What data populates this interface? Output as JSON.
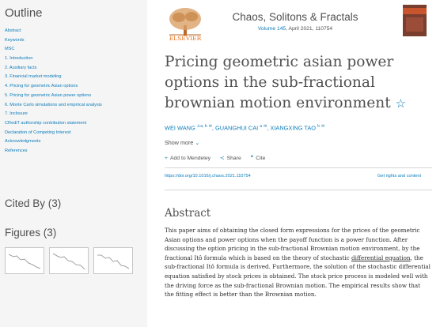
{
  "sidebar": {
    "outline_title": "Outline",
    "items": [
      "Abstract",
      "Keywords",
      "MSC",
      "1. Introduction",
      "2. Auxiliary facts",
      "3. Financial market modeling",
      "4. Pricing for geometric Asian options",
      "5. Pricing for geometric Asian power options",
      "6. Monte Carlo simulations and empirical analysis",
      "7. Inclosure",
      "CRediT authorship contribution statement",
      "Declaration of Competing Interest",
      "Acknowledgments",
      "References"
    ],
    "cited_by": "Cited By (3)",
    "figures": "Figures (3)"
  },
  "journal": {
    "publisher": "ELSEVIER",
    "name": "Chaos, Solitons & Fractals",
    "volume": "Volume 145",
    "date_id": ", April 2021, 110754"
  },
  "article": {
    "title": "Pricing geometric asian power options in the sub-fractional brownian motion environment",
    "authors": [
      {
        "name": "WEI WANG",
        "marks": "a, b"
      },
      {
        "name": "GUANGHUI CAI",
        "marks": "a"
      },
      {
        "name": "XIANGXING TAO",
        "marks": "b"
      }
    ],
    "show_more": "Show more",
    "actions": {
      "mendeley": "Add to Mendeley",
      "share": "Share",
      "cite": "Cite"
    },
    "doi": "https://doi.org/10.1016/j.chaos.2021.110754",
    "rights": "Get rights and content"
  },
  "abstract": {
    "heading": "Abstract",
    "text_before": "This paper aims of obtaining the closed form expressions for the prices of the geometric Asian options and power options when the payoff function is a power function. After discussing the option pricing in the sub-fractional Brownian motion environment, by the fractional Itô formula which is based on the theory of stochastic ",
    "link": "differential equation",
    "text_after": ", the sub-fractional Itô formula is derived. Furthermore, the solution of the stochastic differential equation satisfied by stock prices is obtained. The stock price process is modeled well with the driving force as the sub-fractional Brownian motion. The empirical results show that the fitting effect is better than the Brownian motion."
  },
  "colors": {
    "link": "#0c7dbb",
    "text": "#505050",
    "sidebar_bg": "#f5f5f5",
    "elsevier_orange": "#e9711c"
  }
}
